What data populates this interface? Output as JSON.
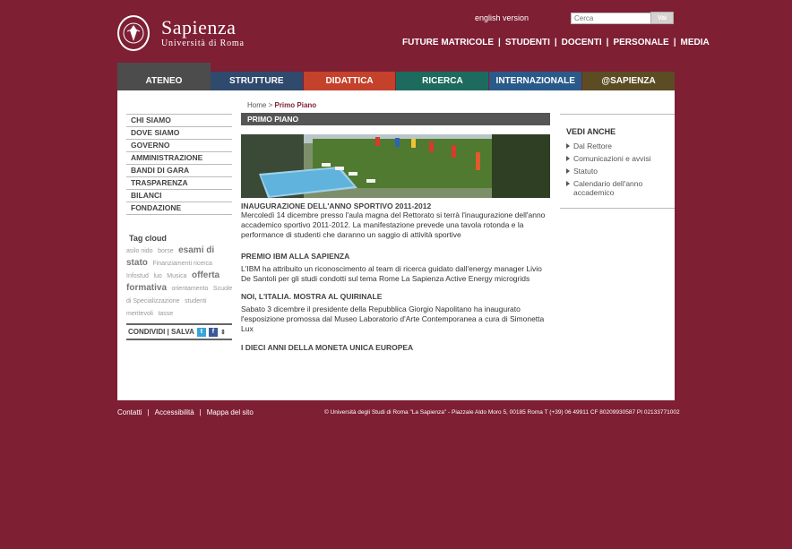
{
  "header": {
    "logo_name": "Sapienza",
    "logo_sub": "Università di Roma",
    "english_link": "english version",
    "search_placeholder": "Cerca",
    "search_button": "Vai",
    "topnav": [
      "FUTURE MATRICOLE",
      "STUDENTI",
      "DOCENTI",
      "PERSONALE",
      "MEDIA"
    ]
  },
  "tabs": [
    {
      "label": "ATENEO",
      "color": "#4c4c4c",
      "active": true
    },
    {
      "label": "STRUTTURE",
      "color": "#2f4a6d"
    },
    {
      "label": "DIDATTICA",
      "color": "#c4412c"
    },
    {
      "label": "RICERCA",
      "color": "#1d6b5e"
    },
    {
      "label": "INTERNAZIONALE",
      "color": "#2a5a8a"
    },
    {
      "label": "@SAPIENZA",
      "color": "#5c4c24"
    }
  ],
  "sidebar": {
    "items": [
      "CHI SIAMO",
      "DOVE SIAMO",
      "GOVERNO",
      "AMMINISTRAZIONE",
      "BANDI DI GARA",
      "TRASPARENZA",
      "BILANCI",
      "FONDAZIONE"
    ],
    "tag_title": "Tag cloud",
    "tags": [
      {
        "text": "asilo nido",
        "size": "s"
      },
      {
        "text": "borse",
        "size": "s"
      },
      {
        "text": "esami di stato",
        "size": "l"
      },
      {
        "text": "Finanziamenti ricerca",
        "size": "s"
      },
      {
        "text": "Infostud",
        "size": "s"
      },
      {
        "text": "luo",
        "size": "s"
      },
      {
        "text": "Musica",
        "size": "s"
      },
      {
        "text": "offerta formativa",
        "size": "l"
      },
      {
        "text": "orientamento",
        "size": "s"
      },
      {
        "text": "Scuole di Specializzazione",
        "size": "s"
      },
      {
        "text": "studenti meritevoli",
        "size": "s"
      },
      {
        "text": "tasse",
        "size": "s"
      }
    ],
    "share_label": "CONDIVIDI | SALVA"
  },
  "main": {
    "breadcrumb_home": "Home",
    "breadcrumb_sep": ">",
    "breadcrumb_current": "Primo Piano",
    "section_title": "PRIMO PIANO",
    "news": [
      {
        "title": "INAUGURAZIONE DELL'ANNO SPORTIVO 2011-2012",
        "text": "Mercoledì 14 dicembre presso l'aula magna del Rettorato si terrà l'inaugurazione dell'anno accademico sportivo 2011-2012. La manifestazione prevede una tavola rotonda e la performance di studenti che daranno un saggio di attività sportive"
      },
      {
        "title": "PREMIO IBM ALLA SAPIENZA",
        "text": "L'IBM ha attribuito un riconoscimento al team di ricerca guidato dall'energy manager Livio De Santoli per gli studi condotti sul tema Rome La Sapienza Active Energy microgrids"
      },
      {
        "title": "NOI, L'ITALIA. MOSTRA AL QUIRINALE",
        "text": "Sabato 3 dicembre il presidente della Repubblica Giorgio Napolitano ha inaugurato l'esposizione promossa dal Museo Laboratorio d'Arte Contemporanea a cura di Simonetta Lux"
      },
      {
        "title": "I DIECI ANNI DELLA MONETA UNICA EUROPEA",
        "text": ""
      }
    ]
  },
  "seealso": {
    "title": "VEDI ANCHE",
    "items": [
      "Dal Rettore",
      "Comunicazioni e avvisi",
      "Statuto",
      "Calendario dell'anno accademico"
    ]
  },
  "footer": {
    "links": [
      "Contatti",
      "Accessibilità",
      "Mappa del sito"
    ],
    "address": "© Università degli Studi di Roma \"La Sapienza\" - Piazzale Aldo Moro 5, 00185 Roma T (+39) 06 49911 CF 80209930587 PI 02133771002"
  },
  "colors": {
    "background": "#7e1f34",
    "panel": "#ffffff",
    "accent": "#7e1f34"
  }
}
